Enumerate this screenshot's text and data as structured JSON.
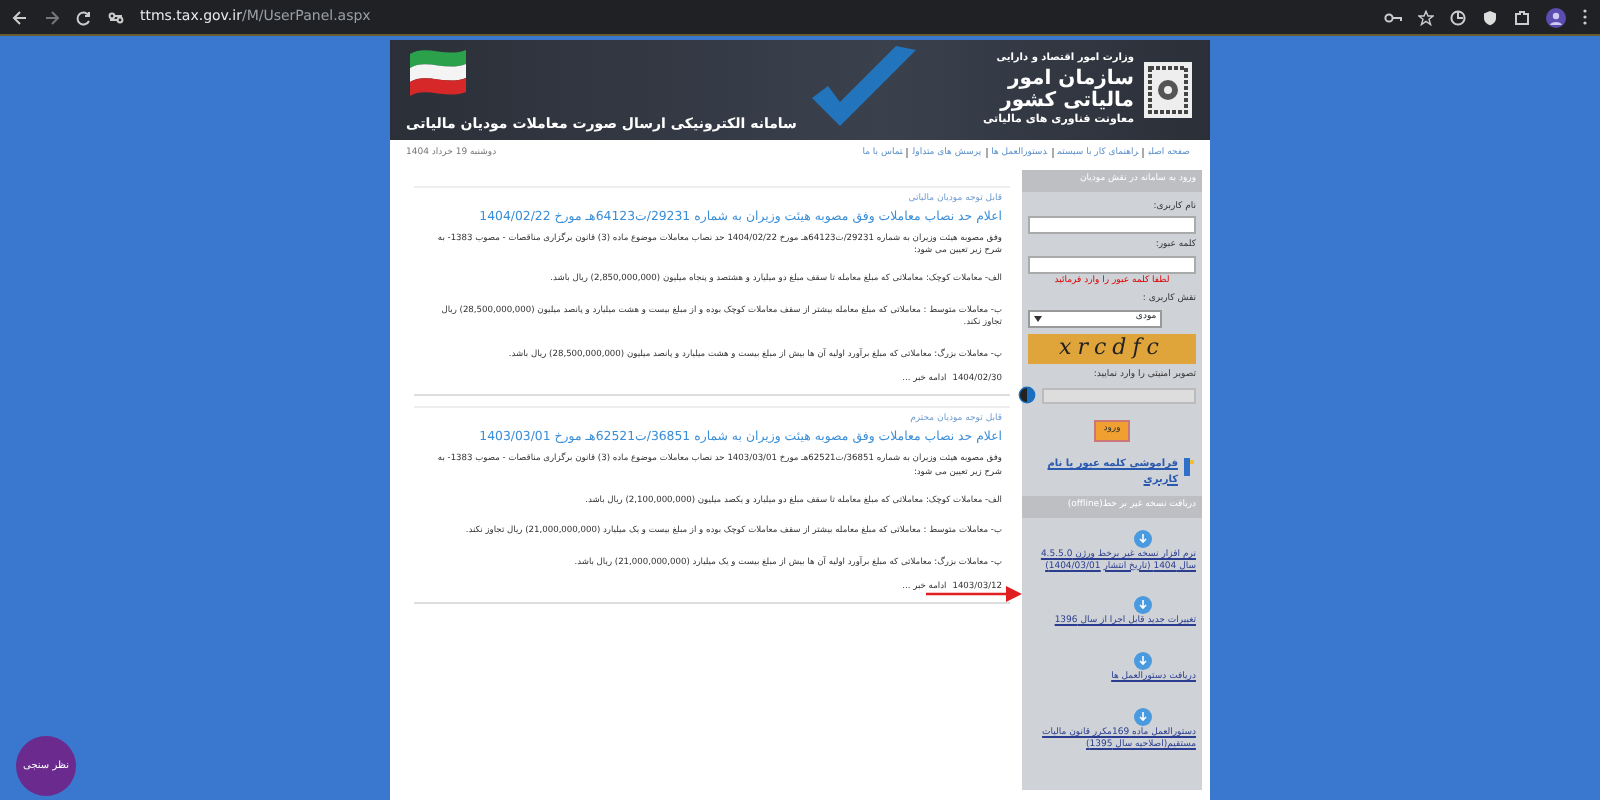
{
  "browser": {
    "url": "ttms.tax.gov.ir/M/UserPanel.aspx"
  },
  "header": {
    "ministry": "وزارت امور اقتصاد و دارایی",
    "organization": "سازمان امور مالیاتی کشور",
    "deputy": "معاونت فناوری های مالیاتی",
    "system_title": "سامانه الکترونیکی ارسال صورت معاملات مودیان مالیاتی"
  },
  "nav": {
    "links": [
      "صفحه اصلی",
      "راهنمای کار با سیستم",
      "دستورالعمل ها",
      "پرسش های متداول",
      "تماس با ما"
    ],
    "date": "دوشنبه 19 خرداد 1404"
  },
  "posts": [
    {
      "kicker": "قابل توجه مودیان مالیاتی",
      "title": "اعلام حد نصاب معاملات وفق مصوبه هیئت وزیران به شماره 29231/ت64123هـ مورخ 1404/02/22",
      "paragraphs": [
        "وفق مصوبه هیئت وزیران به شماره 29231/ت64123هـ مورخ 1404/02/22 حد نصاب معاملات موضوع ماده (3) قانون برگزاری مناقصات - مصوب 1383- به شرح زیر تعیین می شود:",
        "الف- معاملات کوچک: معاملاتی که مبلغ معامله تا سقف مبلغ دو میلیارد و هشتصد و پنجاه میلیون (2,850,000,000) ریال باشد.",
        "ب- معاملات متوسط : معاملاتی که مبلغ معامله بیشتر از سقف معاملات کوچک بوده و از مبلغ بیست و هشت میلیارد و پانصد میلیون (28,500,000,000) ریال تجاوز نکند.",
        "پ- معاملات بزرگ: معاملاتی که مبلغ برآورد اولیه آن ها بیش از مبلغ بیست و هشت میلیارد و پانصد میلیون (28,500,000,000) ریال باشد."
      ],
      "date": "1404/02/30",
      "more": "ادامه خبر ..."
    },
    {
      "kicker": "قابل توجه مودیان محترم",
      "title": "اعلام حد نصاب معاملات وفق مصوبه هیئت وزیران به شماره 36851/ت62521هـ مورخ 1403/03/01",
      "paragraphs": [
        "وفق مصوبه هیئت وزیران به شماره 36851/ت62521هـ مورخ 1403/03/01 حد نصاب معاملات موضوع ماده (3) قانون برگزاری مناقصات - مصوب 1383- به شرح زیر تعیین می شود:",
        "الف- معاملات کوچک: معاملاتی که مبلغ معامله تا سقف مبلغ دو میلیارد و یکصد میلیون (2,100,000,000) ریال باشد.",
        "ب- معاملات متوسط : معاملاتی که مبلغ معامله بیشتر از سقف معاملات کوچک بوده و از مبلغ بیست و یک میلیارد (21,000,000,000) ریال تجاوز نکند.",
        "پ- معاملات بزرگ: معاملاتی که مبلغ برآورد اولیه آن ها بیش از مبلغ بیست و یک میلیارد (21,000,000,000) ریال باشد."
      ],
      "date": "1403/03/12",
      "more": "ادامه خبر ..."
    }
  ],
  "login": {
    "title": "ورود به سامانه در نقش مودیان",
    "username_label": "نام کاربری:",
    "password_label": "کلمه عبور:",
    "error": "لطفا کلمه عبور را وارد فرمائید",
    "role_label": "نقش کاربری :",
    "role_value": "مودی",
    "captcha": "xrcdfc",
    "captcha_label": "تصویر امنیتی را وارد نمایید:",
    "submit": "ورود",
    "forgot": "فراموشی کلمه عبور یا نام کاربری"
  },
  "downloads": {
    "title": "دریافت نسخه غیر بر خط(offline)",
    "items": [
      "نرم افزار نسخه غیر برخط ورژن 4.5.5.0 سال 1404 (تاریخ انتشار 1404/03/01)",
      "تغییرات جدید قابل اجرا از سال 1396",
      "دریافت دستورالعمل ها",
      "دستورالعمل ماده 169مکرر قانون مالیات مستقیم(اصلاحیه سال 1395)"
    ]
  },
  "survey_button": "نظر سنجی"
}
